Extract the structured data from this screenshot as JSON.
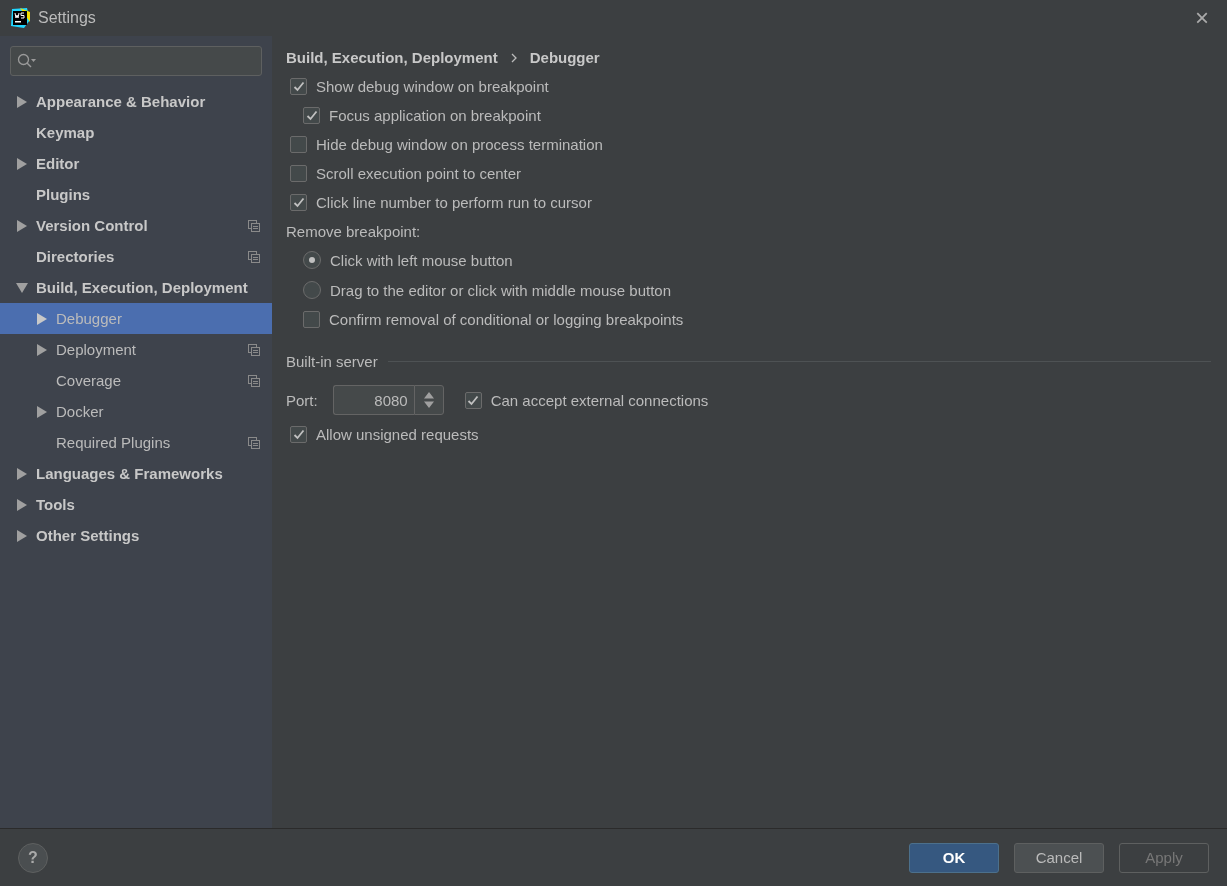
{
  "window": {
    "title": "Settings",
    "close": "×"
  },
  "sidebar": {
    "items": [
      {
        "label": "Appearance & Behavior",
        "expanded": false,
        "selected": false,
        "project_icon": false
      },
      {
        "label": "Keymap",
        "selected": false,
        "project_icon": false
      },
      {
        "label": "Editor",
        "expanded": false,
        "selected": false,
        "project_icon": false
      },
      {
        "label": "Plugins",
        "selected": false,
        "project_icon": false
      },
      {
        "label": "Version Control",
        "expanded": false,
        "selected": false,
        "project_icon": true
      },
      {
        "label": "Directories",
        "selected": false,
        "project_icon": true
      },
      {
        "label": "Build, Execution, Deployment",
        "expanded": true,
        "selected": false,
        "project_icon": false,
        "children": [
          {
            "label": "Debugger",
            "expanded": false,
            "selected": true,
            "project_icon": false
          },
          {
            "label": "Deployment",
            "expanded": false,
            "selected": false,
            "project_icon": true
          },
          {
            "label": "Coverage",
            "selected": false,
            "project_icon": true
          },
          {
            "label": "Docker",
            "expanded": false,
            "selected": false,
            "project_icon": false
          },
          {
            "label": "Required Plugins",
            "selected": false,
            "project_icon": true
          }
        ]
      },
      {
        "label": "Languages & Frameworks",
        "expanded": false,
        "selected": false,
        "project_icon": false
      },
      {
        "label": "Tools",
        "expanded": false,
        "selected": false,
        "project_icon": false
      },
      {
        "label": "Other Settings",
        "expanded": false,
        "selected": false,
        "project_icon": false
      }
    ]
  },
  "breadcrumb": [
    "Build, Execution, Deployment",
    "Debugger"
  ],
  "options": [
    {
      "kind": "checkbox",
      "label": "Show debug window on breakpoint",
      "checked": true,
      "children": [
        {
          "kind": "checkbox",
          "label": "Focus application on breakpoint",
          "checked": true
        }
      ]
    },
    {
      "kind": "checkbox",
      "label": "Hide debug window on process termination",
      "checked": false
    },
    {
      "kind": "checkbox",
      "label": "Scroll execution point to center",
      "checked": false
    },
    {
      "kind": "checkbox",
      "label": "Click line number to perform run to cursor",
      "checked": true
    },
    {
      "kind": "label",
      "label": "Remove breakpoint:",
      "children": [
        {
          "kind": "radio",
          "label": "Click with left mouse button",
          "selected": true
        },
        {
          "kind": "radio",
          "label": "Drag to the editor or click with middle mouse button",
          "selected": false
        },
        {
          "kind": "checkbox",
          "label": "Confirm removal of conditional or logging breakpoints",
          "checked": false
        }
      ]
    }
  ],
  "built_in_server": {
    "title": "Built-in server",
    "port_label": "Port:",
    "port": "8080",
    "external": {
      "label": "Can accept external connections",
      "checked": true
    },
    "unsigned": {
      "label": "Allow unsigned requests",
      "checked": true
    }
  },
  "footer": {
    "help": "?",
    "buttons": [
      {
        "label": "OK",
        "kind": "primary",
        "disabled": false
      },
      {
        "label": "Cancel",
        "kind": "normal",
        "disabled": false
      },
      {
        "label": "Apply",
        "kind": "normal",
        "disabled": true
      }
    ]
  }
}
